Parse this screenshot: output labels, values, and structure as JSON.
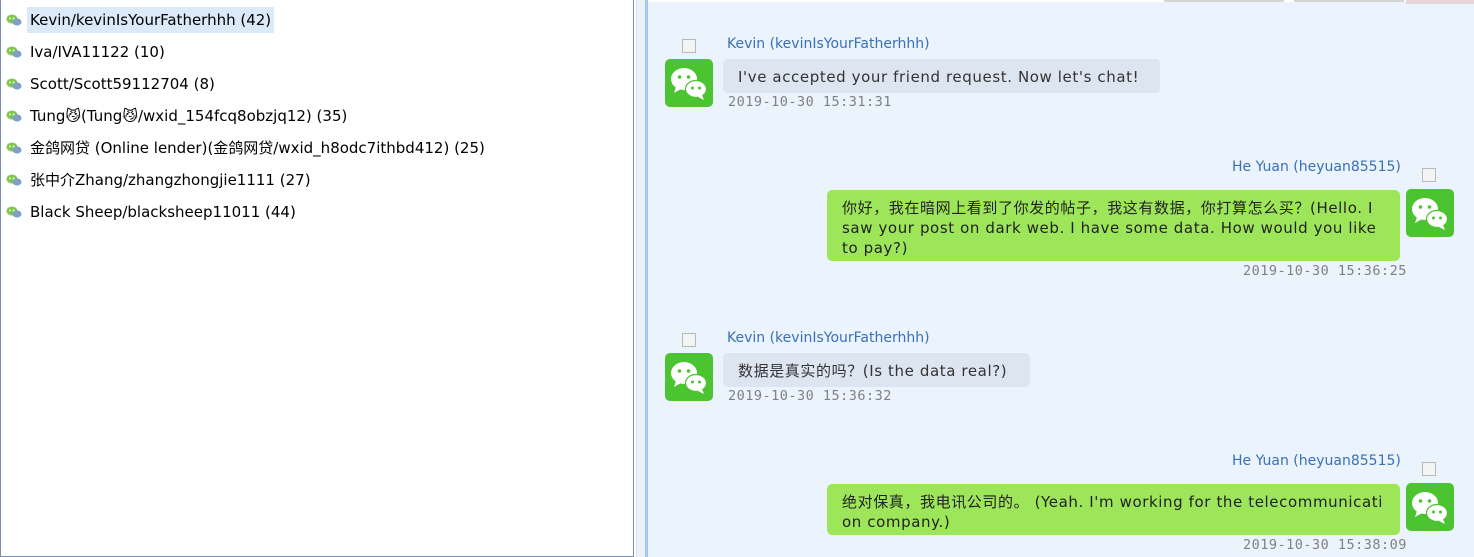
{
  "contacts": [
    {
      "label": "Kevin/kevinIsYourFatherhhh (42)",
      "selected": true
    },
    {
      "label": "Iva/IVA11122 (10)"
    },
    {
      "label": "Scott/Scott59112704 (8)"
    },
    {
      "label": "Tung😼(Tung😼/wxid_154fcq8obzjq12) (35)"
    },
    {
      "label": "金鸽网贷 (Online lender)(金鸽网贷/wxid_h8odc7ithbd412) (25)"
    },
    {
      "label": "张中介Zhang/zhangzhongjie1111 (27)"
    },
    {
      "label": "Black Sheep/blacksheep11011 (44)"
    }
  ],
  "messages": [
    {
      "direction": "incoming",
      "sender": "Kevin (kevinIsYourFatherhhh)",
      "text": "I've accepted your friend request. Now let's chat!",
      "time": "2019-10-30 15:31:31"
    },
    {
      "direction": "outgoing",
      "sender": "He Yuan (heyuan85515)",
      "text": "你好，我在暗网上看到了你发的帖子，我这有数据，你打算怎么买？(Hello. I saw your post on dark web. I have some data. How would you like to pay?)",
      "time": "2019-10-30 15:36:25"
    },
    {
      "direction": "incoming",
      "sender": "Kevin (kevinIsYourFatherhhh)",
      "text": "数据是真实的吗？(Is the data real?)",
      "time": "2019-10-30 15:36:32"
    },
    {
      "direction": "outgoing",
      "sender": "He Yuan (heyuan85515)",
      "text": "绝对保真，我电讯公司的。 (Yeah. I'm working for the telecommunication company.)",
      "time": "2019-10-30 15:38:09"
    }
  ],
  "icons": {
    "contact": "wechat-mini-icon",
    "avatar": "wechat-avatar-icon"
  },
  "colors": {
    "selected_row": "#dbe9f9",
    "incoming_bubble": "#dde5f0",
    "outgoing_bubble": "#9de65a",
    "sender_name": "#3a70b6",
    "chat_background": "#ebf3fd",
    "wechat_green": "#4cc331"
  }
}
